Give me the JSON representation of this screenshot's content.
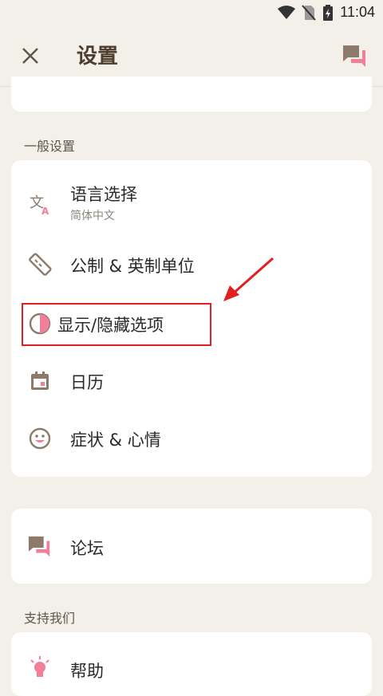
{
  "status_bar": {
    "time": "11:04",
    "icons": [
      "wifi-icon",
      "no-sim-icon",
      "battery-charging-icon"
    ]
  },
  "app_bar": {
    "title": "设置",
    "close_icon": "close-icon",
    "chat_icon": "chat-bubbles-icon"
  },
  "sections": {
    "general_header": "一般设置",
    "support_header": "支持我们"
  },
  "general_items": [
    {
      "label": "语言选择",
      "sub": "简体中文",
      "icon": "translate-icon"
    },
    {
      "label": "公制 & 英制单位",
      "icon": "ruler-icon"
    },
    {
      "label": "显示/隐藏选项",
      "icon": "half-circle-icon"
    },
    {
      "label": "日历",
      "icon": "calendar-icon"
    },
    {
      "label": "症状 & 心情",
      "icon": "smiley-icon"
    }
  ],
  "community_items": [
    {
      "label": "论坛",
      "icon": "chat-bubbles-icon"
    }
  ],
  "support_items": [
    {
      "label": "帮助",
      "icon": "lightbulb-icon"
    }
  ],
  "colors": {
    "background": "#f3f0e9",
    "title_brown": "#4e3c2c",
    "icon_brown": "#8e7a6a",
    "accent_pink": "#f07f97",
    "annotation_red": "#e02020"
  }
}
